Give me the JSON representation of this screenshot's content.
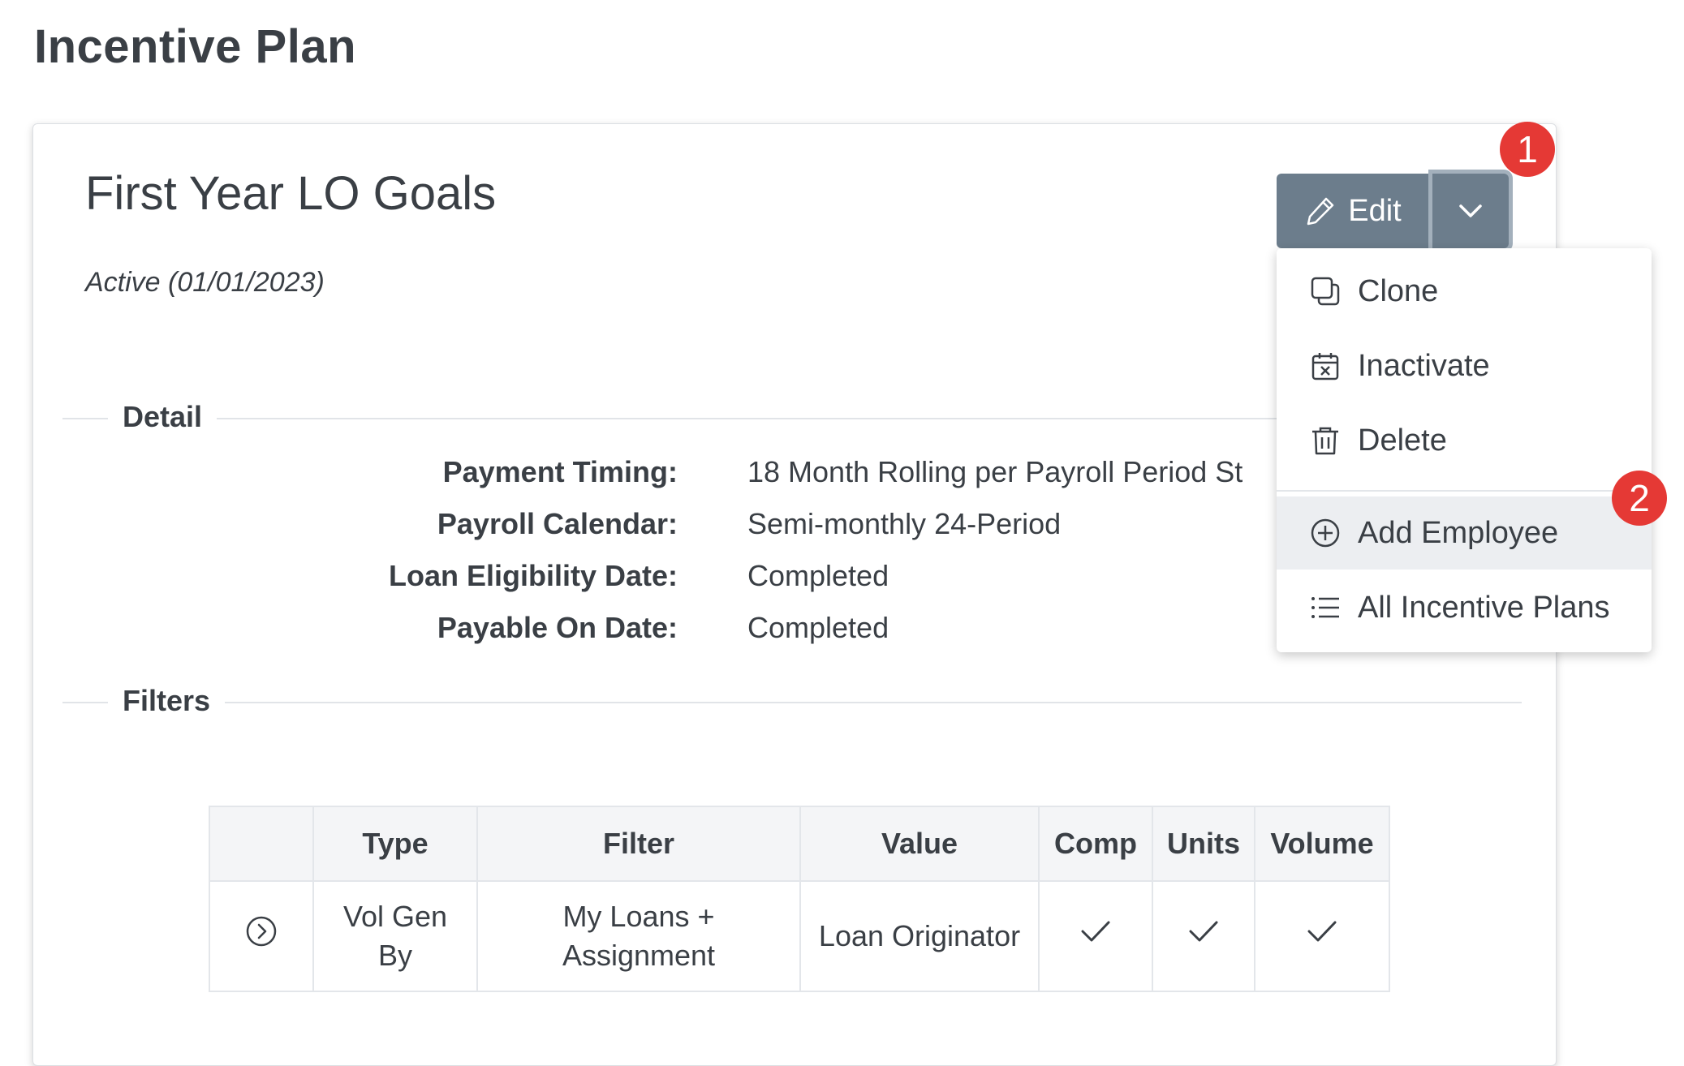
{
  "page": {
    "title": "Incentive Plan"
  },
  "plan": {
    "name": "First Year LO Goals",
    "status": "Active (01/01/2023)"
  },
  "detail": {
    "section_label": "Detail",
    "rows": [
      {
        "label": "Payment Timing:",
        "value": "18 Month Rolling per Payroll Period St"
      },
      {
        "label": "Payroll Calendar:",
        "value": "Semi-monthly 24-Period"
      },
      {
        "label": "Loan Eligibility Date:",
        "value": "Completed"
      },
      {
        "label": "Payable On Date:",
        "value": "Completed"
      }
    ]
  },
  "filters": {
    "section_label": "Filters",
    "columns": [
      "",
      "Type",
      "Filter",
      "Value",
      "Comp",
      "Units",
      "Volume"
    ],
    "rows": [
      {
        "expand_icon": "chevron-right-circle-icon",
        "type_line1": "Vol Gen",
        "type_line2": "By",
        "filter_line1": "My Loans +",
        "filter_line2": "Assignment",
        "value": "Loan Originator",
        "comp": "check-icon",
        "units": "check-icon",
        "volume": "check-icon"
      }
    ]
  },
  "actions": {
    "edit_label": "Edit",
    "edit_icon": "pencil-icon",
    "dropdown_icon": "chevron-down-icon",
    "menu": [
      {
        "label": "Clone",
        "icon": "copy-icon"
      },
      {
        "label": "Inactivate",
        "icon": "calendar-x-icon"
      },
      {
        "label": "Delete",
        "icon": "trash-icon"
      },
      {
        "label": "Add Employee",
        "icon": "plus-circle-icon",
        "highlighted": true
      },
      {
        "label": "All Incentive Plans",
        "icon": "list-icon"
      }
    ]
  },
  "callouts": {
    "badge1": "1",
    "badge2": "2",
    "color": "#e53935"
  },
  "colors": {
    "button": "#6c7d8c",
    "highlight": "#eceef1",
    "text": "#3a3f45"
  }
}
